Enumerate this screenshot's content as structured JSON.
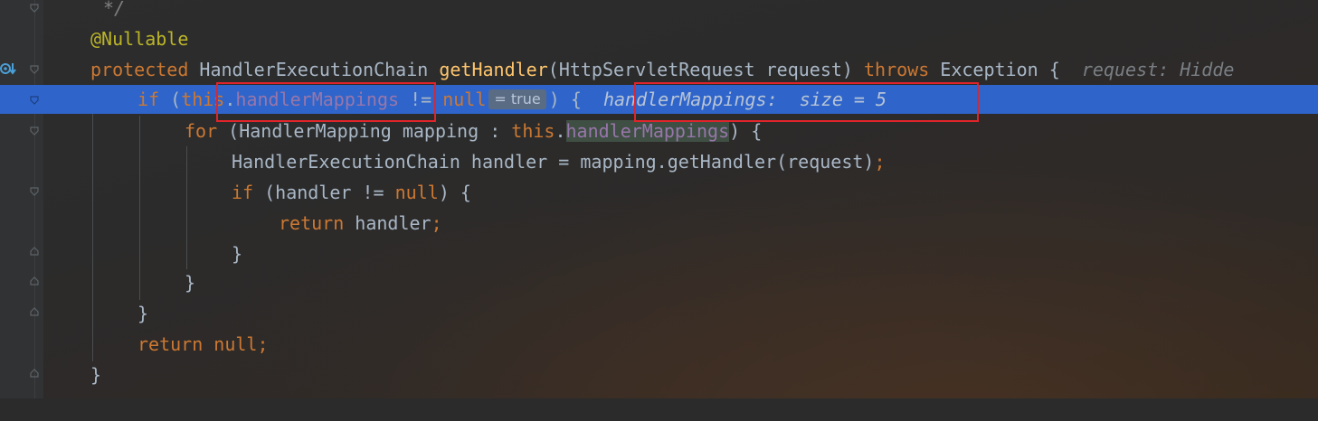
{
  "editor": {
    "lines": [
      {
        "comment": "*/"
      },
      {
        "annotation": "@Nullable"
      },
      {
        "kw_protected": "protected",
        "type_ret": "HandlerExecutionChain",
        "method": "getHandler",
        "open": "(",
        "param_type": "HttpServletRequest",
        "param_name": "request",
        "close": ")",
        "kw_throws": "throws",
        "exc": "Exception",
        "brace": "{",
        "hint": "request: Hidde"
      },
      {
        "kw_if": "if",
        "open": "(",
        "kw_this": "this",
        "dot": ".",
        "field": "handlerMappings",
        "op": "!=",
        "kw_null": "null",
        "inlay": "= true",
        "close": ")",
        "brace": "{",
        "hint": "handlerMappings:  size = 5"
      },
      {
        "kw_for": "for",
        "open": "(",
        "type": "HandlerMapping",
        "var": "mapping",
        "colon": ":",
        "kw_this": "this",
        "dot": ".",
        "field": "handlerMappings",
        "close": ")",
        "brace": "{"
      },
      {
        "type": "HandlerExecutionChain",
        "var": "handler",
        "eq": "=",
        "call": "mapping.getHandler(request)",
        "semi": ";"
      },
      {
        "kw_if": "if",
        "cond": "(handler !=",
        "kw_null": "null",
        "close": ")",
        "brace": "{"
      },
      {
        "kw_return": "return",
        "var": "handler",
        "semi": ";"
      },
      {
        "brace": "}"
      },
      {
        "brace": "}"
      },
      {
        "brace": "}"
      },
      {
        "kw_return": "return",
        "kw_null": "null",
        "semi": ";"
      },
      {
        "brace": "}"
      }
    ]
  },
  "colors": {
    "current_line": "#2f65ca",
    "keyword": "#cc7832",
    "method": "#ffc66d",
    "field": "#9876aa",
    "annotation": "#bbb529",
    "highlight_box": "#e0242a"
  },
  "icons": [
    "fold-marker-icon",
    "breakpoint-debug-icon"
  ]
}
